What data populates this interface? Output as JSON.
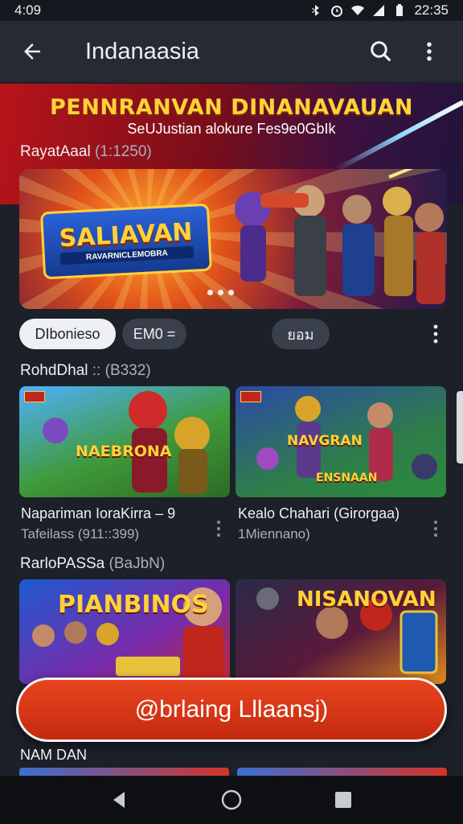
{
  "status_bar": {
    "time": "4:09",
    "clock": "22:35",
    "icons": [
      "bluetooth-icon",
      "alarm-icon",
      "wifi-icon",
      "signal-icon",
      "battery-icon"
    ]
  },
  "app_bar": {
    "title": "Indanaasia",
    "icons": [
      "back-arrow-icon",
      "search-icon",
      "more-vert-icon"
    ]
  },
  "hero": {
    "title": "PENNRANVAN DINANAVAUAN",
    "subtitle": "SeUJustian alokure Fes9e0GbIk"
  },
  "featured_section": {
    "label": "RayatAaal",
    "count": "(1:1250)",
    "banner_title": "SALIAVAN",
    "banner_subtitle": "RAVARNICLEMOBRA",
    "page_dots": 3
  },
  "chips": [
    {
      "label": "DIbonieso",
      "active": true
    },
    {
      "label": "EM0 =",
      "active": false
    },
    {
      "label": "ยอม",
      "active": false
    }
  ],
  "section2": {
    "label": "RohdDhal",
    "count": ":: (B332)",
    "cards": [
      {
        "art_title": "NAEBRONA",
        "title": "Napariman IoraKirra – 9",
        "meta": "Tafeilass (911::399)"
      },
      {
        "art_title": "NAVGRAN",
        "art_title2": "ENSNAAN",
        "title": "Kealo Chahari (Girorgaa)",
        "meta": "1Miennano)"
      }
    ]
  },
  "section3": {
    "label": "RarloPASSa",
    "count": "(BaJbN)",
    "cards": [
      {
        "art_title": "PIANBINOS"
      },
      {
        "art_title": "NISANOVAN"
      }
    ]
  },
  "cta": {
    "label": "@brlaing Lllaansj)"
  },
  "bottom_section": {
    "label": "NAM DAN"
  },
  "colors": {
    "background": "#1c2028",
    "app_bar": "#252a33",
    "accent_red": "#d4351a",
    "gold": "#ffd23a"
  }
}
